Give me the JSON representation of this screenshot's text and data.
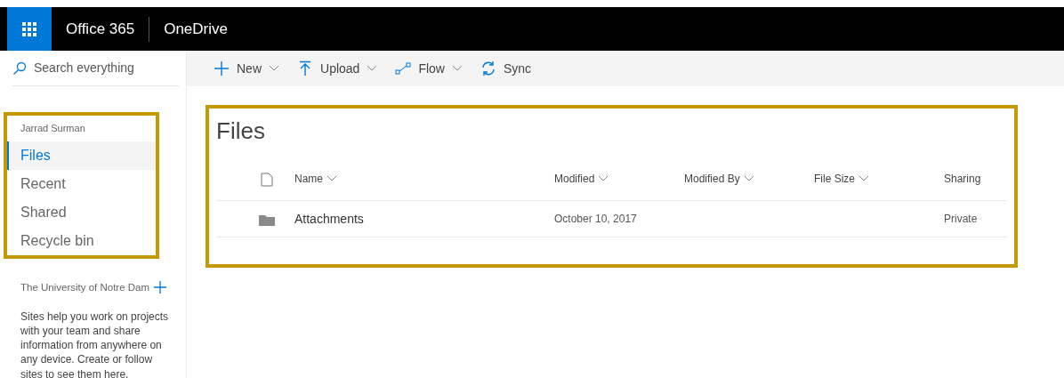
{
  "header": {
    "brand": "Office 365",
    "app": "OneDrive"
  },
  "search": {
    "placeholder": "Search everything"
  },
  "commands": [
    {
      "label": "New",
      "dropdown": true
    },
    {
      "label": "Upload",
      "dropdown": true
    },
    {
      "label": "Flow",
      "dropdown": true
    },
    {
      "label": "Sync",
      "dropdown": false
    }
  ],
  "sidebar": {
    "user": "Jarrad Surman",
    "items": [
      {
        "label": "Files",
        "selected": true
      },
      {
        "label": "Recent",
        "selected": false
      },
      {
        "label": "Shared",
        "selected": false
      },
      {
        "label": "Recycle bin",
        "selected": false
      }
    ],
    "sites_heading": "The University of Notre Dam",
    "sites_text": "Sites help you work on projects with your team and share information from anywhere on any device. Create or follow sites to see them here."
  },
  "page_title": "Files",
  "table": {
    "columns": [
      {
        "label": "Name",
        "sortable": true
      },
      {
        "label": "Modified",
        "sortable": true
      },
      {
        "label": "Modified By",
        "sortable": true
      },
      {
        "label": "File Size",
        "sortable": true
      },
      {
        "label": "Sharing",
        "sortable": false
      }
    ],
    "rows": [
      {
        "kind": "folder",
        "name": "Attachments",
        "modified": "October 10, 2017",
        "sharing": "Private"
      }
    ]
  }
}
